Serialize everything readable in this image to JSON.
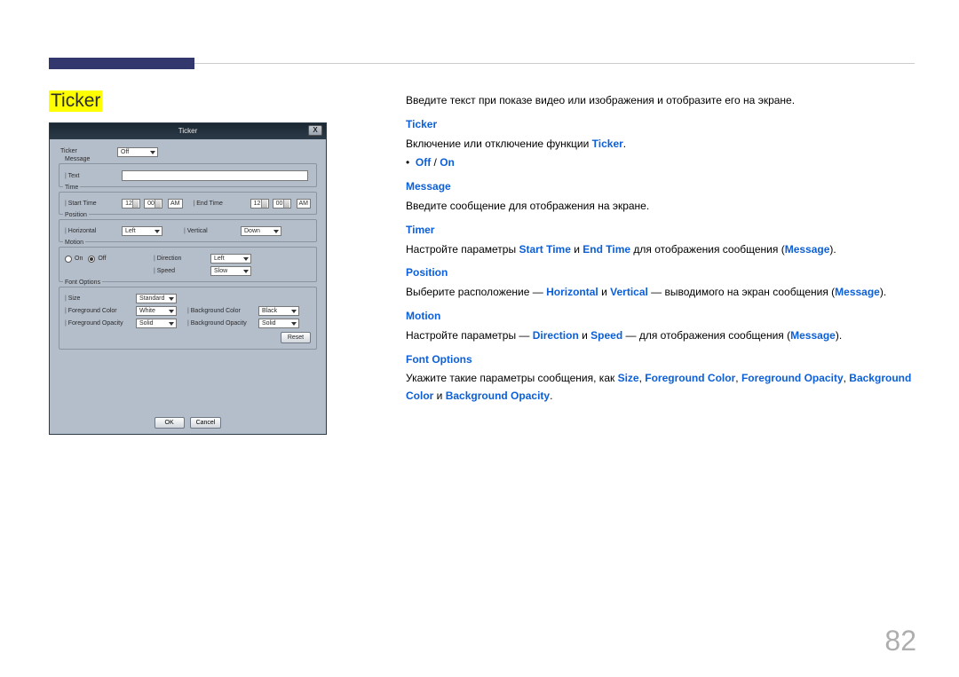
{
  "page_number": "82",
  "section_title": "Ticker",
  "dialog": {
    "title": "Ticker",
    "close": "X",
    "ticker_label": "Ticker",
    "ticker_value": "Off",
    "message_group": "Message",
    "text_label": "Text",
    "text_value": "",
    "time_group": "Time",
    "start_label": "Start Time",
    "end_label": "End Time",
    "start_h": "12",
    "start_m": "00",
    "start_ap": "AM",
    "end_h": "12",
    "end_m": "00",
    "end_ap": "AM",
    "position_group": "Position",
    "horizontal_label": "Horizontal",
    "horizontal_value": "Left",
    "vertical_label": "Vertical",
    "vertical_value": "Down",
    "motion_group": "Motion",
    "on_label": "On",
    "off_label": "Off",
    "direction_label": "Direction",
    "direction_value": "Left",
    "speed_label": "Speed",
    "speed_value": "Slow",
    "font_group": "Font Options",
    "size_label": "Size",
    "size_value": "Standard",
    "fg_color_label": "Foreground Color",
    "fg_color_value": "White",
    "fg_opacity_label": "Foreground Opacity",
    "fg_opacity_value": "Solid",
    "bg_color_label": "Background Color",
    "bg_color_value": "Black",
    "bg_opacity_label": "Background Opacity",
    "bg_opacity_value": "Solid",
    "reset": "Reset",
    "ok": "OK",
    "cancel": "Cancel"
  },
  "desc": {
    "intro": "Введите текст при показе видео или изображения и отобразите его на экране.",
    "ticker_h": "Ticker",
    "ticker_p1": "Включение или отключение функции ",
    "ticker_hl": "Ticker",
    "off": "Off",
    "slash": " / ",
    "on": "On",
    "message_h": "Message",
    "message_p": "Введите сообщение для отображения на экране.",
    "timer_h": "Timer",
    "timer_p1": "Настройте параметры ",
    "timer_start": "Start Time",
    "timer_and": " и ",
    "timer_end": "End Time",
    "timer_p2": " для отображения сообщения (",
    "timer_msg": "Message",
    "timer_p3": ").",
    "position_h": "Position",
    "pos_p1": "Выберите расположение — ",
    "pos_hor": "Horizontal",
    "pos_and": " и ",
    "pos_ver": "Vertical",
    "pos_p2": " — выводимого на экран сообщения (",
    "pos_msg": "Message",
    "pos_p3": ").",
    "motion_h": "Motion",
    "mot_p1": "Настройте параметры — ",
    "mot_dir": "Direction",
    "mot_and": " и ",
    "mot_spd": "Speed",
    "mot_p2": " — для отображения сообщения (",
    "mot_msg": "Message",
    "mot_p3": ").",
    "font_h": "Font Options",
    "font_p1": "Укажите такие параметры сообщения, как ",
    "font_size": "Size",
    "c1": ", ",
    "font_fgc": "Foreground Color",
    "c2": ", ",
    "font_fgo": "Foreground Opacity",
    "c3": ", ",
    "font_bgc": "Background Color",
    "font_p2": " и ",
    "font_bgo": "Background Opacity",
    "font_p3": "."
  }
}
